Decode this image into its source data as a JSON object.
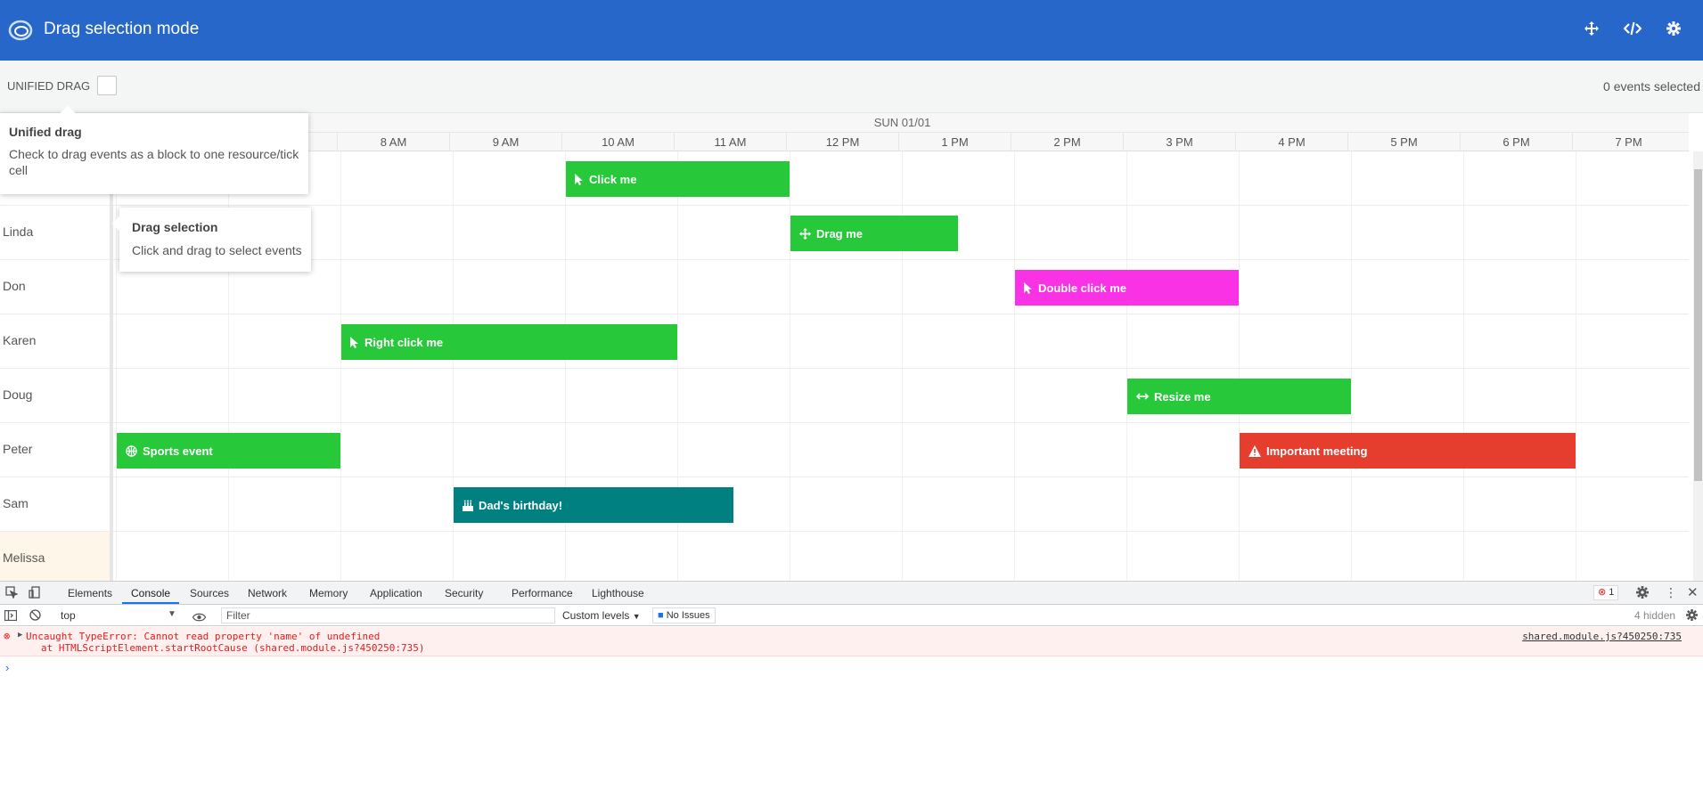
{
  "header": {
    "title": "Drag selection mode",
    "logo_icon": "bryntum-logo-icon",
    "buttons": [
      {
        "name": "fullscreen-icon"
      },
      {
        "name": "code-icon"
      },
      {
        "name": "settings-icon"
      }
    ],
    "bg_color": "#2667c9"
  },
  "toolbar": {
    "unified_drag_label": "UNIFIED DRAG",
    "selection_count": "0 events selected"
  },
  "tooltips": {
    "unified": {
      "title": "Unified drag",
      "body": "Check to drag events as a block to one resource/tick cell"
    },
    "drag": {
      "title": "Drag selection",
      "body": "Click and drag to select events"
    }
  },
  "timeline": {
    "date_header": "SUN 01/01",
    "ticks": [
      "8 AM",
      "9 AM",
      "10 AM",
      "11 AM",
      "12 PM",
      "1 PM",
      "2 PM",
      "3 PM",
      "4 PM",
      "5 PM",
      "6 PM",
      "7 PM"
    ]
  },
  "resources": [
    "",
    "Linda",
    "Don",
    "Karen",
    "Doug",
    "Peter",
    "Sam",
    "Melissa"
  ],
  "events": [
    {
      "name": "Click me",
      "resource": 0,
      "icon": "pointer-icon",
      "color": "#27c93a"
    },
    {
      "name": "Drag me",
      "resource": 1,
      "icon": "move-icon",
      "color": "#27c93a"
    },
    {
      "name": "Double click me",
      "resource": 2,
      "icon": "pointer-icon",
      "color": "#f932e6"
    },
    {
      "name": "Right click me",
      "resource": 3,
      "icon": "pointer-icon",
      "color": "#27c93a"
    },
    {
      "name": "Resize me",
      "resource": 4,
      "icon": "resize-icon",
      "color": "#27c93a"
    },
    {
      "name": "Sports event",
      "resource": 5,
      "icon": "basketball-icon",
      "color": "#27c93a"
    },
    {
      "name": "Important meeting",
      "resource": 5,
      "icon": "warning-icon",
      "color": "#e53e2e"
    },
    {
      "name": "Dad's birthday!",
      "resource": 6,
      "icon": "birthday-cake-icon",
      "color": "#008080"
    }
  ],
  "devtools": {
    "tabs": [
      "Elements",
      "Console",
      "Sources",
      "Network",
      "Memory",
      "Application",
      "Security",
      "Performance",
      "Lighthouse"
    ],
    "active_tab": "Console",
    "error_count": "1",
    "context": "top",
    "filter_placeholder": "Filter",
    "levels": "Custom levels",
    "issues": "No Issues",
    "hidden": "4 hidden",
    "error_line1": "Uncaught TypeError: Cannot read property 'name' of undefined",
    "error_line2": "at HTMLScriptElement.startRootCause (shared.module.js?450250:735)",
    "error_source": "shared.module.js?450250:735",
    "prompt": "›"
  }
}
